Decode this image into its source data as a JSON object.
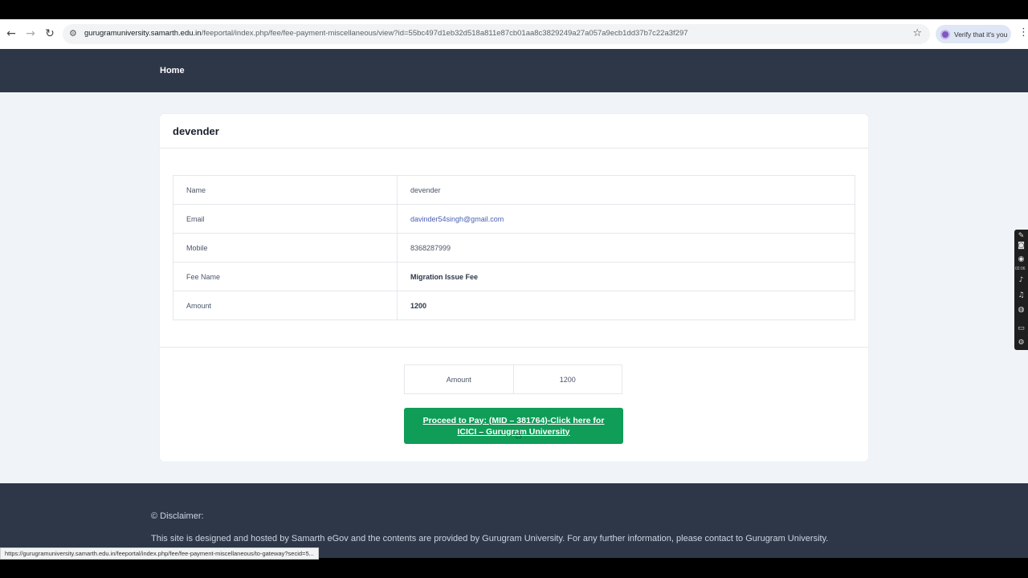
{
  "browser": {
    "url_host": "gurugramuniversity.samarth.edu.in",
    "url_path": "/feeportal/index.php/fee/fee-payment-miscellaneous/view?id=55bc497d1eb32d518a811e87cb01aa8c3829249a27a057a9ecb1dd37b7c22a3f297",
    "verify_label": "Verify that it's you",
    "status_url": "https://gurugramuniversity.samarth.edu.in/feeportal/index.php/fee/fee-payment-miscellaneous/to-gateway?secid=5..."
  },
  "nav": {
    "home": "Home"
  },
  "card": {
    "title": "devender",
    "rows": [
      {
        "label": "Name",
        "value": "devender"
      },
      {
        "label": "Email",
        "value": "davinder54singh@gmail.com"
      },
      {
        "label": "Mobile",
        "value": "8368287999"
      },
      {
        "label": "Fee Name",
        "value": "Migration Issue Fee"
      },
      {
        "label": "Amount",
        "value": "1200"
      }
    ],
    "summary": {
      "label": "Amount",
      "value": "1200"
    },
    "pay_button": "Proceed to Pay: (MID – 381764)-Click here for ICICI – Gurugram University"
  },
  "footer": {
    "disclaimer_title": "© Disclaimer:",
    "disclaimer_text": "This site is designed and hosted by Samarth eGov and the contents are provided by Gurugram University. For any further information, please contact to Gurugram University."
  },
  "recorder": {
    "time": "02:06"
  }
}
